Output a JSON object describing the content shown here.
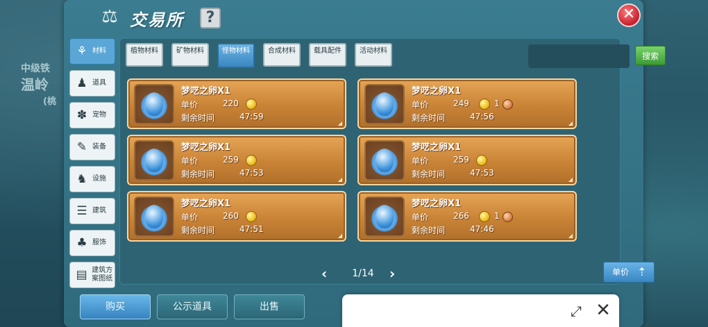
{
  "world": {
    "line1": "中级铁",
    "line2": "温岭",
    "line3": "(桃"
  },
  "header": {
    "title": "交易所",
    "help_label": "?",
    "close_label": "✕",
    "title_icon": "scale-icon"
  },
  "sidebar": {
    "items": [
      {
        "label": "材料",
        "icon": "materials-icon",
        "glyph": "⚘",
        "active": true
      },
      {
        "label": "道具",
        "icon": "item-icon",
        "glyph": "♟",
        "active": false
      },
      {
        "label": "宠物",
        "icon": "paw-icon",
        "glyph": "✽",
        "active": false
      },
      {
        "label": "装备",
        "icon": "equipment-icon",
        "glyph": "✎",
        "active": false
      },
      {
        "label": "设施",
        "icon": "facility-icon",
        "glyph": "♞",
        "active": false
      },
      {
        "label": "建筑",
        "icon": "building-icon",
        "glyph": "☰",
        "active": false
      },
      {
        "label": "服饰",
        "icon": "clothing-icon",
        "glyph": "♣",
        "active": false
      },
      {
        "label": "建筑方案图纸",
        "icon": "blueprint-icon",
        "glyph": "▤",
        "active": false
      }
    ]
  },
  "tabs": [
    {
      "label": "植物材料",
      "active": false
    },
    {
      "label": "矿物材料",
      "active": false
    },
    {
      "label": "怪物材料",
      "active": true
    },
    {
      "label": "合成材料",
      "active": false
    },
    {
      "label": "载具配件",
      "active": false
    },
    {
      "label": "活动材料",
      "active": false
    }
  ],
  "search": {
    "placeholder": "",
    "button_label": "搜索"
  },
  "listings": [
    {
      "name": "梦呓之卵X1",
      "price_label": "单价",
      "price": "220",
      "extra": "",
      "time_label": "剩余时间",
      "time": "47:59"
    },
    {
      "name": "梦呓之卵X1",
      "price_label": "单价",
      "price": "249",
      "extra": "1",
      "time_label": "剩余时间",
      "time": "47:56"
    },
    {
      "name": "梦呓之卵X1",
      "price_label": "单价",
      "price": "259",
      "extra": "",
      "time_label": "剩余时间",
      "time": "47:53"
    },
    {
      "name": "梦呓之卵X1",
      "price_label": "单价",
      "price": "259",
      "extra": "",
      "time_label": "剩余时间",
      "time": "47:53"
    },
    {
      "name": "梦呓之卵X1",
      "price_label": "单价",
      "price": "260",
      "extra": "",
      "time_label": "剩余时间",
      "time": "47:51"
    },
    {
      "name": "梦呓之卵X1",
      "price_label": "单价",
      "price": "266",
      "extra": "1",
      "time_label": "剩余时间",
      "time": "47:46"
    }
  ],
  "pagination": {
    "prev": "‹",
    "text": "1/14",
    "next": "›"
  },
  "sort": {
    "label": "单价",
    "arrow": "⇡"
  },
  "bottom": {
    "buy": "购买",
    "public": "公示道具",
    "sell": "出售"
  },
  "popup": {
    "expand_label": "⤢",
    "close_label": "✕"
  },
  "colors": {
    "accent": "#3a87c1",
    "card": "#c98336",
    "search": "#3c9a35",
    "close": "#c51f2d"
  }
}
